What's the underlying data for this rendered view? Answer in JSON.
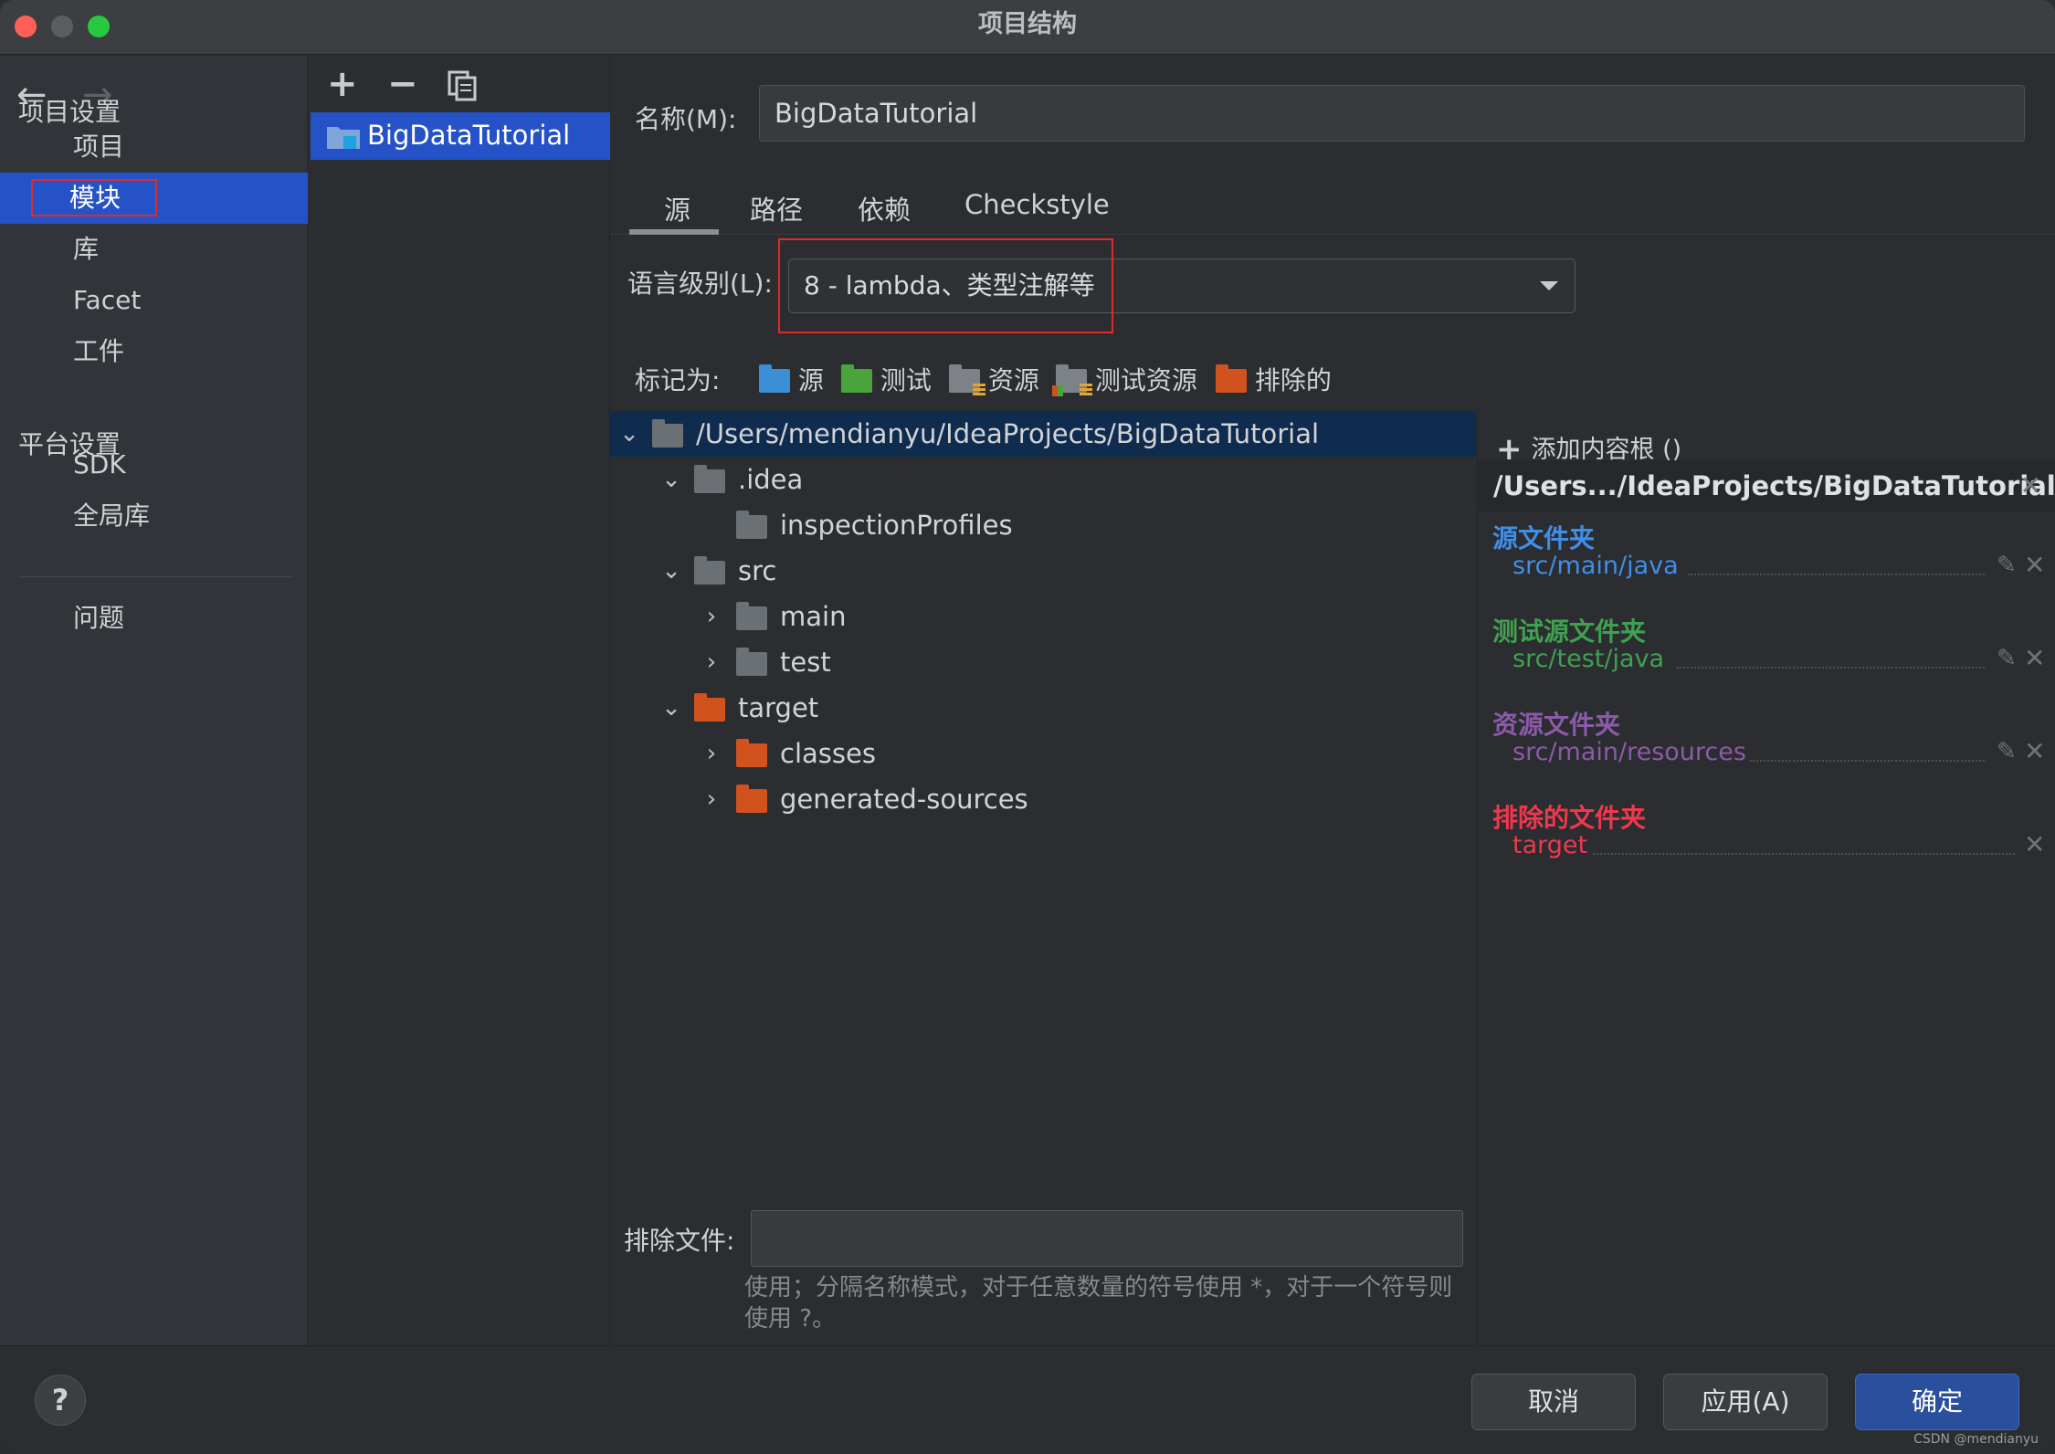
{
  "window": {
    "title": "项目结构"
  },
  "nav": {
    "project_settings_heading": "项目设置",
    "platform_settings_heading": "平台设置",
    "items": [
      {
        "label": "项目"
      },
      {
        "label": "模块"
      },
      {
        "label": "库"
      },
      {
        "label": "Facet"
      },
      {
        "label": "工件"
      },
      {
        "label": "SDK"
      },
      {
        "label": "全局库"
      },
      {
        "label": "问题"
      }
    ]
  },
  "modules": {
    "list": [
      {
        "label": "BigDataTutorial"
      }
    ]
  },
  "module_settings": {
    "name_label": "名称(M):",
    "name_value": "BigDataTutorial",
    "tabs": [
      {
        "label": "源"
      },
      {
        "label": "路径"
      },
      {
        "label": "依赖"
      },
      {
        "label": "Checkstyle"
      }
    ],
    "language_level_label": "语言级别(L):",
    "language_level_value": "8 - lambda、类型注解等",
    "mark_as_label": "标记为:",
    "mark_as": [
      {
        "label": "源",
        "color": "#3a8fd6"
      },
      {
        "label": "测试",
        "color": "#4ba33b"
      },
      {
        "label": "资源",
        "color": "#7c8287"
      },
      {
        "label": "测试资源",
        "color": "#7c8287"
      },
      {
        "label": "排除的",
        "color": "#d2521e"
      }
    ],
    "tree": [
      {
        "label": "/Users/mendianyu/IdeaProjects/BigDataTutorial",
        "state": "expanded"
      },
      {
        "label": ".idea",
        "state": "expanded"
      },
      {
        "label": "inspectionProfiles",
        "state": "leaf"
      },
      {
        "label": "src",
        "state": "expanded"
      },
      {
        "label": "main",
        "state": "collapsed"
      },
      {
        "label": "test",
        "state": "collapsed"
      },
      {
        "label": "target",
        "state": "expanded"
      },
      {
        "label": "classes",
        "state": "collapsed"
      },
      {
        "label": "generated-sources",
        "state": "collapsed"
      }
    ],
    "exclude_files_label": "排除文件:",
    "exclude_files_value": "",
    "exclude_hint": "使用；分隔名称模式，对于任意数量的符号使用 *，对于一个符号则使用 ?。"
  },
  "content_roots": {
    "add_label": "添加内容根 ()",
    "root_path": "/Users.../IdeaProjects/BigDataTutorial",
    "sections": [
      {
        "title": "源文件夹",
        "path": "src/main/java",
        "color": "#3f8ee8"
      },
      {
        "title": "测试源文件夹",
        "path": "src/test/java",
        "color": "#3fa14f"
      },
      {
        "title": "资源文件夹",
        "path": "src/main/resources",
        "color": "#8c5aa8"
      },
      {
        "title": "排除的文件夹",
        "path": "target",
        "color": "#f0384d"
      }
    ]
  },
  "footer": {
    "help": "?",
    "cancel": "取消",
    "apply": "应用(A)",
    "ok": "确定",
    "watermark": "CSDN @mendianyu"
  }
}
